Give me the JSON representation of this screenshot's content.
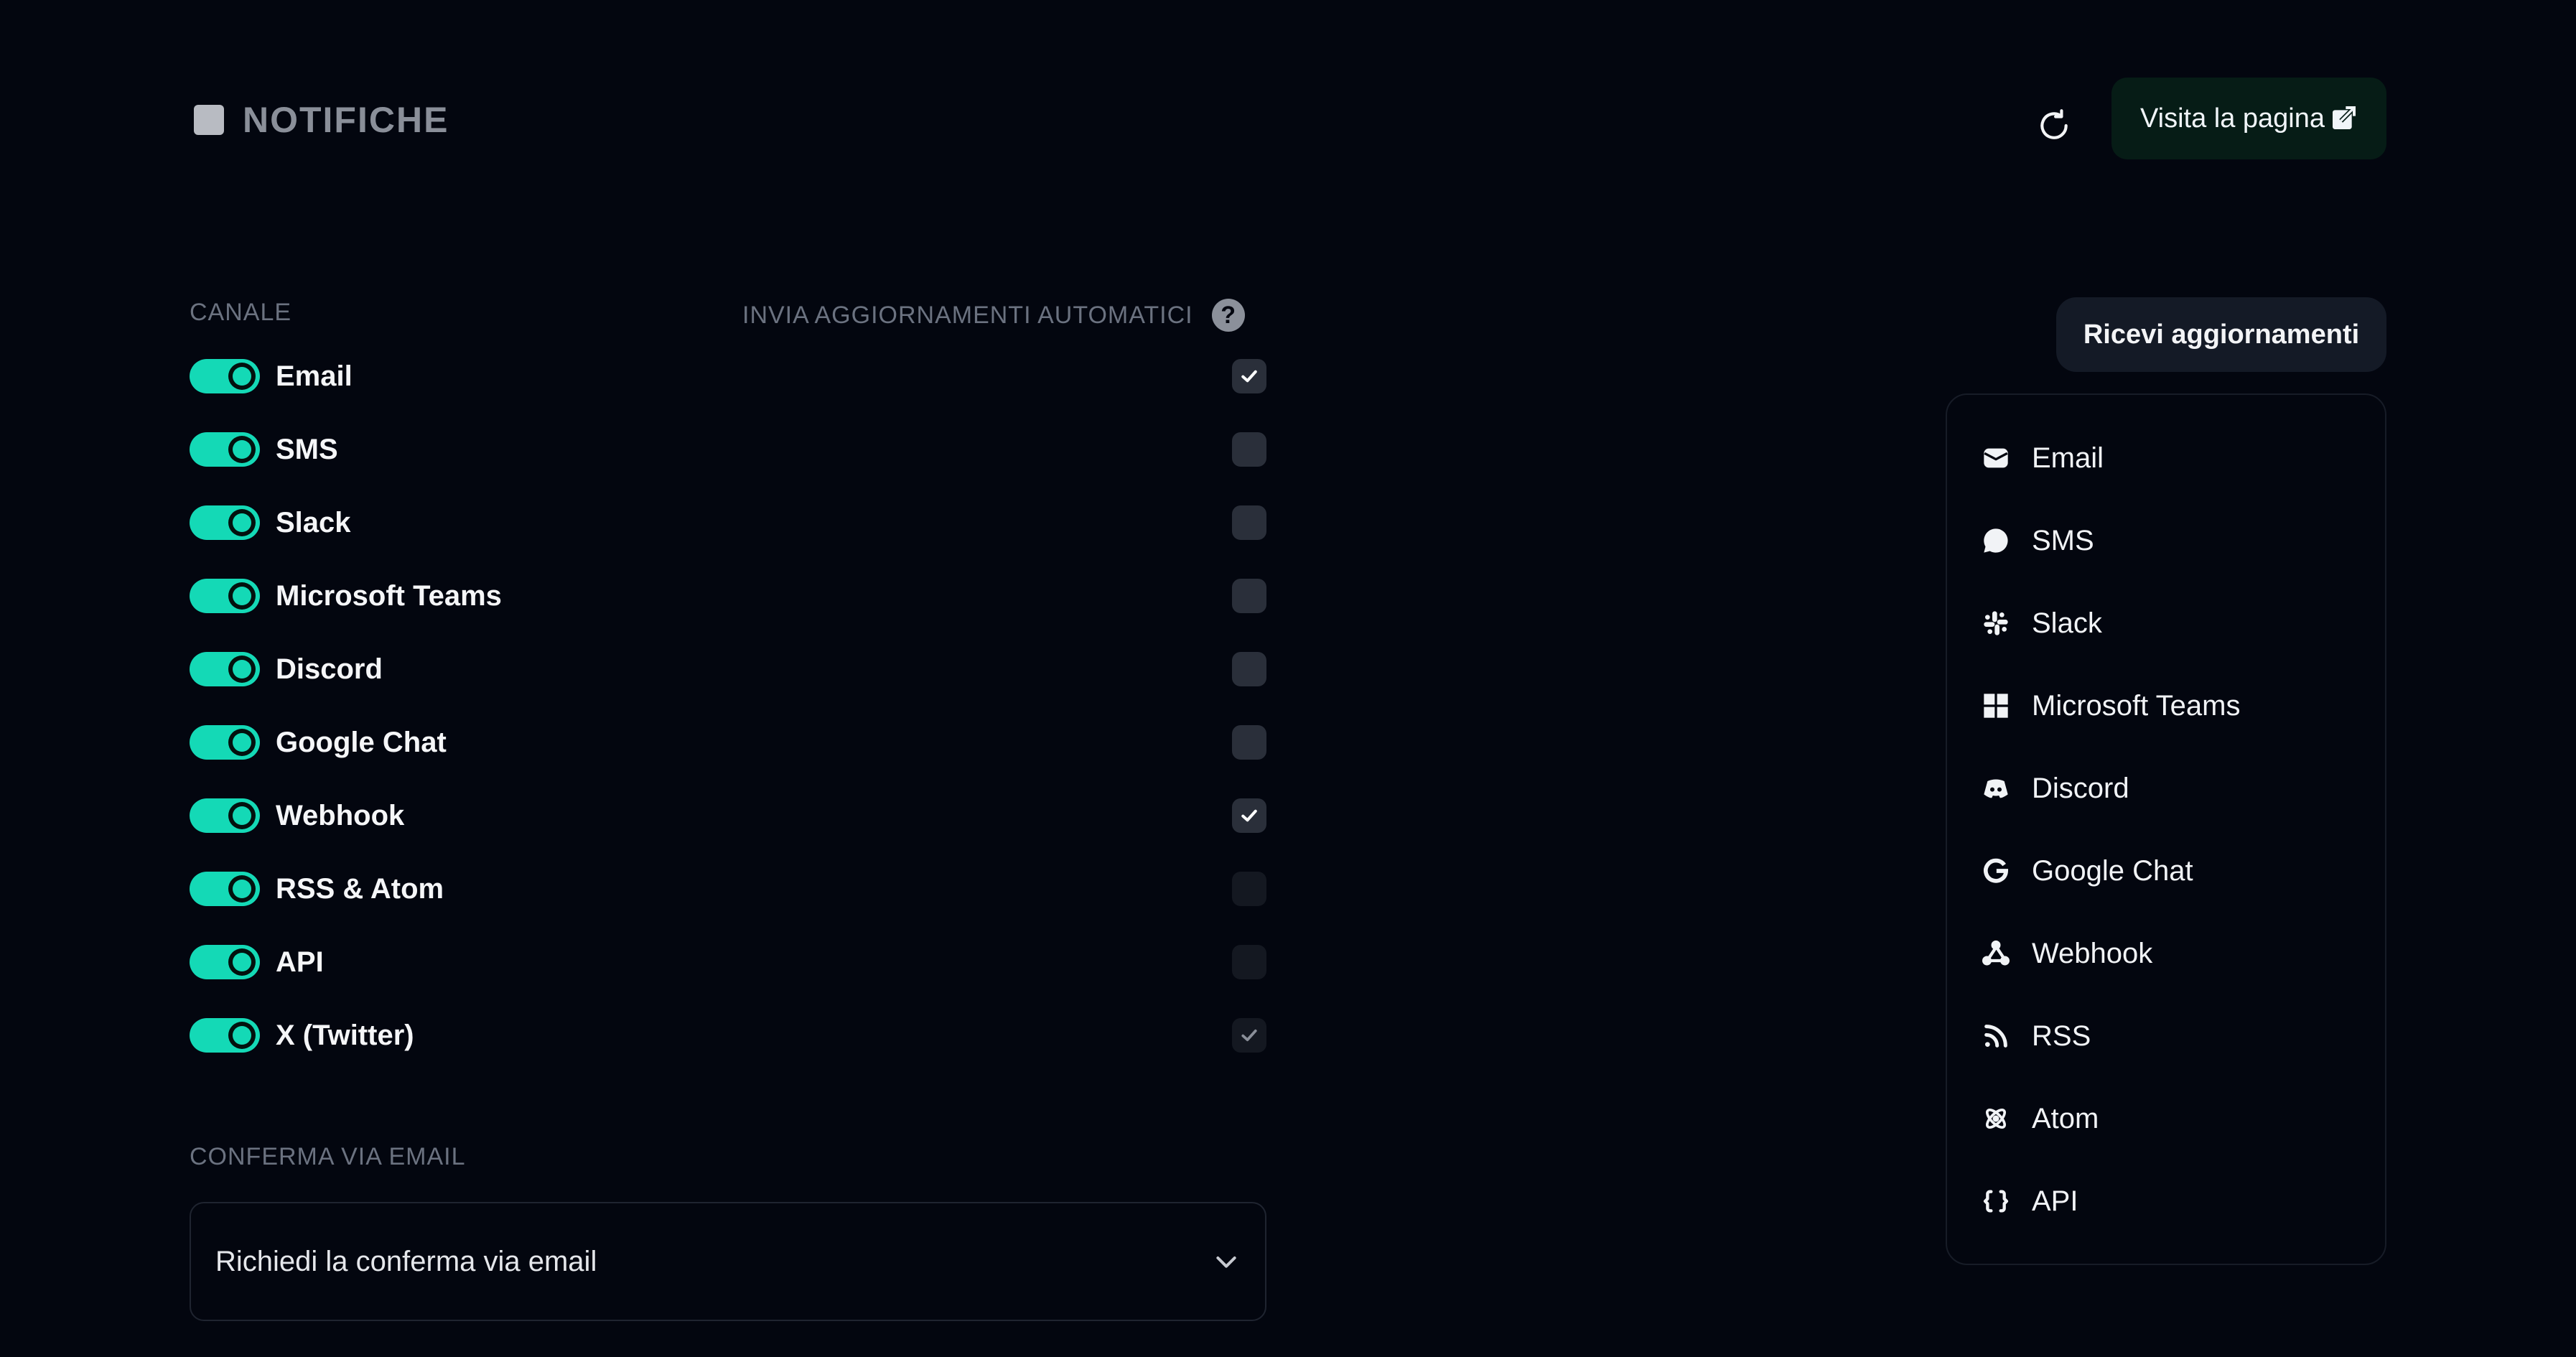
{
  "header": {
    "title": "NOTIFICHE",
    "visit_label": "Visita la pagina"
  },
  "columns": {
    "channel": "CANALE",
    "auto_updates": "INVIA AGGIORNAMENTI AUTOMATICI",
    "help": "?"
  },
  "channels": [
    {
      "label": "Email",
      "enabled": true,
      "auto": true
    },
    {
      "label": "SMS",
      "enabled": true,
      "auto": false
    },
    {
      "label": "Slack",
      "enabled": true,
      "auto": false
    },
    {
      "label": "Microsoft Teams",
      "enabled": true,
      "auto": false
    },
    {
      "label": "Discord",
      "enabled": true,
      "auto": false
    },
    {
      "label": "Google Chat",
      "enabled": true,
      "auto": false
    },
    {
      "label": "Webhook",
      "enabled": true,
      "auto": true
    },
    {
      "label": "RSS & Atom",
      "enabled": true,
      "auto": false
    },
    {
      "label": "API",
      "enabled": true,
      "auto": false
    },
    {
      "label": "X (Twitter)",
      "enabled": true,
      "auto": true
    }
  ],
  "confirm": {
    "heading": "CONFERMA VIA EMAIL",
    "selected": "Richiedi la conferma via email"
  },
  "subscribe": {
    "button": "Ricevi aggiornamenti",
    "items": [
      {
        "label": "Email",
        "icon": "envelope-icon"
      },
      {
        "label": "SMS",
        "icon": "chat-bubble-icon"
      },
      {
        "label": "Slack",
        "icon": "slack-icon"
      },
      {
        "label": "Microsoft Teams",
        "icon": "windows-icon"
      },
      {
        "label": "Discord",
        "icon": "discord-icon"
      },
      {
        "label": "Google Chat",
        "icon": "google-icon"
      },
      {
        "label": "Webhook",
        "icon": "webhook-icon"
      },
      {
        "label": "RSS",
        "icon": "rss-icon"
      },
      {
        "label": "Atom",
        "icon": "atom-icon"
      },
      {
        "label": "API",
        "icon": "braces-icon"
      }
    ]
  },
  "colors": {
    "background": "#03060f",
    "accent": "#14d9b6",
    "visit_button": "#061c16"
  }
}
